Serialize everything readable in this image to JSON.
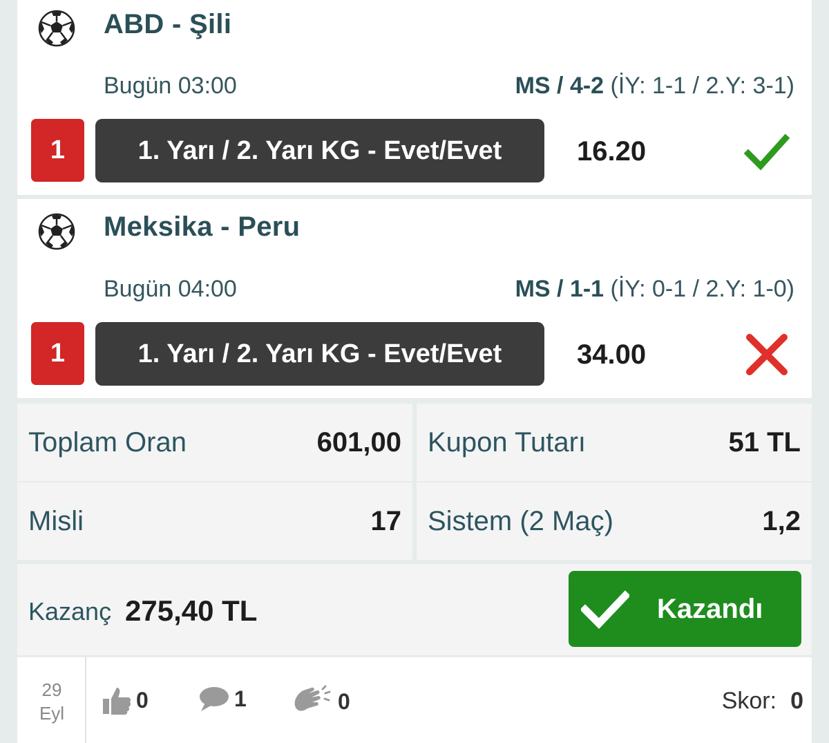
{
  "matches": [
    {
      "teams": "ABD - Şili",
      "time": "Bugün 03:00",
      "result_main": "MS / 4-2",
      "result_detail": " (İY: 1-1 / 2.Y: 3-1)",
      "rank": "1",
      "pick": "1. Yarı / 2. Yarı KG - Evet/Evet",
      "odd": "16.20",
      "status": "won",
      "status_icon": "check-icon",
      "status_color": "#2e9a1e"
    },
    {
      "teams": "Meksika - Peru",
      "time": "Bugün 04:00",
      "result_main": "MS / 1-1",
      "result_detail": " (İY: 0-1 / 2.Y: 1-0)",
      "rank": "1",
      "pick": "1. Yarı / 2. Yarı KG - Evet/Evet",
      "odd": "34.00",
      "status": "lost",
      "status_icon": "cross-icon",
      "status_color": "#e0302a"
    }
  ],
  "summary": {
    "total_odds_label": "Toplam Oran",
    "total_odds_value": "601,00",
    "coupon_amount_label": "Kupon Tutarı",
    "coupon_amount_value": "51 TL",
    "multiplier_label": "Misli",
    "multiplier_value": "17",
    "system_label": "Sistem (2 Maç)",
    "system_value": "1,2"
  },
  "winnings": {
    "label": "Kazanç",
    "value": "275,40 TL",
    "status_button": "Kazandı",
    "status_color": "#1e8d1e"
  },
  "footer": {
    "date_day": "29",
    "date_month": "Eyl",
    "likes": "0",
    "comments": "1",
    "applause": "0",
    "score_label": "Skor:",
    "score_value": "0"
  },
  "colors": {
    "team_text": "#2b4f57",
    "rank_badge": "#d32626",
    "pick_bg": "#3c3c3c",
    "background": "#e6eceb"
  }
}
